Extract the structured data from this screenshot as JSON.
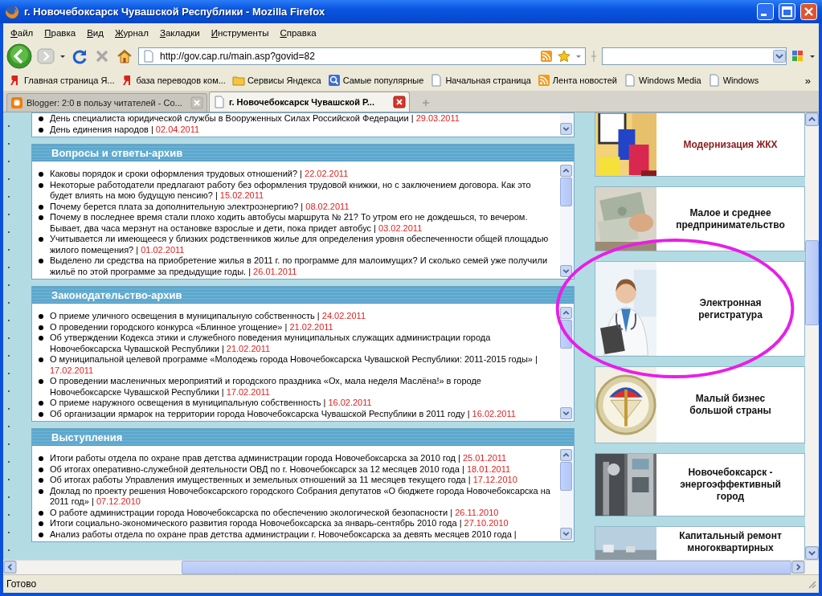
{
  "window": {
    "title": "г. Новочебоксарск Чувашской Республики - Mozilla Firefox"
  },
  "menu": [
    "Файл",
    "Правка",
    "Вид",
    "Журнал",
    "Закладки",
    "Инструменты",
    "Справка"
  ],
  "address": {
    "url": "http://gov.cap.ru/main.asp?govid=82"
  },
  "bookmarks": [
    {
      "label": "Главная страница Я...",
      "kind": "yandex"
    },
    {
      "label": "база переводов ком...",
      "kind": "yandex"
    },
    {
      "label": "Сервисы Яндекса",
      "kind": "folder"
    },
    {
      "label": "Самые популярные",
      "kind": "search"
    },
    {
      "label": "Начальная страница",
      "kind": "page"
    },
    {
      "label": "Лента новостей",
      "kind": "rss"
    },
    {
      "label": "Windows Media",
      "kind": "page"
    },
    {
      "label": "Windows",
      "kind": "page"
    }
  ],
  "bookmarks_more": "»",
  "tabs": [
    {
      "label": "Blogger: 2:0 в пользу читателей - Co...",
      "kind": "blogger",
      "selected": false
    },
    {
      "label": "г. Новочебоксарск Чувашской Р...",
      "kind": "page",
      "selected": true
    }
  ],
  "page": {
    "top_list": [
      {
        "text": "День специалиста юридической службы в Вооруженных Силах Российской Федерации |",
        "date": "29.03.2011"
      },
      {
        "text": "День единения народов |",
        "date": "02.04.2011"
      }
    ],
    "sections": [
      {
        "title": "Вопросы и ответы-архив",
        "items": [
          {
            "text": "Каковы порядок и сроки оформления трудовых отношений? |",
            "date": "22.02.2011"
          },
          {
            "text": "Некоторые работодатели предлагают работу без оформления трудовой книжки, но с заключением договора. Как это будет влиять на мою будущую пенсию? |",
            "date": "15.02.2011"
          },
          {
            "text": "Почему берется плата за дополнительную электроэнергию? |",
            "date": "08.02.2011"
          },
          {
            "text": "Почему в последнее время стали плохо ходить автобусы маршрута № 21? То утром его не дождешься, то вечером. Бывает, два часа мерзнут на остановке взрослые и дети, пока придет автобус |",
            "date": "03.02.2011"
          },
          {
            "text": "Учитывается ли имеющееся у близких родственников жилье для определения уровня обеспеченности общей площадью жилого помещения? |",
            "date": "01.02.2011"
          },
          {
            "text": "Выделено ли средства на приобретение жилья в 2011 г. по программе для малоимущих? И сколько семей уже получили жильё по этой программе за предыдущие годы. |",
            "date": "26.01.2011"
          }
        ]
      },
      {
        "title": "Законодательство-архив",
        "items": [
          {
            "text": "О приеме уличного освещения в муниципальную собственность |",
            "date": "24.02.2011"
          },
          {
            "text": "О проведении городского конкурса «Блинное угощение» |",
            "date": "21.02.2011"
          },
          {
            "text": "Об утверждении Кодекса этики и служебного поведения муниципальных служащих администрации города Новочебоксарска Чувашской Республики |",
            "date": "21.02.2011"
          },
          {
            "text": "О муниципальной целевой программе «Молодежь города Новочебоксарска Чувашской Республики: 2011-2015 годы» |",
            "date": "17.02.2011"
          },
          {
            "text": "О проведении масленичных мероприятий и городского праздника «Ох, мала неделя Маслёна!» в городе Новочебоксарске Чувашской Республики |",
            "date": "17.02.2011"
          },
          {
            "text": "О приеме наружного освещения в муниципальную собственность |",
            "date": "16.02.2011"
          },
          {
            "text": "Об организации ярмарок на территории города Новочебоксарска Чувашской Республики в 2011 году |",
            "date": "16.02.2011"
          }
        ]
      },
      {
        "title": "Выступления",
        "items": [
          {
            "text": "Итоги работы отдела по охране прав детства администрации города Новочебоксарска за 2010 год |",
            "date": "25.01.2011"
          },
          {
            "text": "Об итогах оперативно-служебной деятельности ОВД по г. Новочебоксарск за 12 месяцев 2010 года |",
            "date": "18.01.2011"
          },
          {
            "text": "Об итогах работы Управления имущественных и земельных отношений за 11 месяцев текущего года |",
            "date": "17.12.2010"
          },
          {
            "text": "Доклад по проекту решения Новочебоксарского городского Собрания депутатов «О бюджете города Новочебоксарска на 2011 год» |",
            "date": "07.12.2010"
          },
          {
            "text": "О работе администрации города Новочебоксарска по обеспечению экологической безопасности |",
            "date": "26.11.2010"
          },
          {
            "text": "Итоги социально-экономического развития города Новочебоксарска за январь-сентябрь 2010 года |",
            "date": "27.10.2010"
          },
          {
            "text": "Анализ работы отдела по охране прав детства администрации г. Новочебоксарска за девять месяцев 2010 года |"
          }
        ]
      }
    ],
    "banners": [
      {
        "title": "Модернизация ЖКХ",
        "color": "#8b1a1a"
      },
      {
        "title": "Малое и среднее\nпредпринимательство",
        "color": "#111111"
      },
      {
        "title": "Электронная\nрегистратура",
        "color": "#111111"
      },
      {
        "title": "Малый бизнес\nбольшой страны",
        "color": "#111111"
      },
      {
        "title": "Новочебоксарск -\nэнергоэффективный\nгород",
        "color": "#111111"
      },
      {
        "title": "Капитальный ремонт\nмногоквартирных",
        "color": "#111111"
      }
    ]
  },
  "status_bar": "Готово"
}
